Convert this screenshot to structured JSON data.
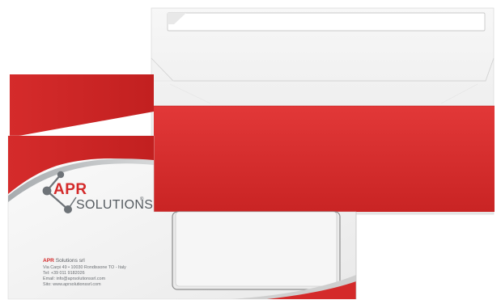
{
  "brand": {
    "apr": "APR",
    "solutions": "SOLUTIONS",
    "registered": "®"
  },
  "address": {
    "company_prefix": "APR",
    "company_rest": " Solutions srl",
    "street": "Via Carpi 49 • 10030 Rondissone TO - Italy",
    "tel": "Tel:   +39 011 9182026",
    "email": "Email: info@aprsolutionssrl.com",
    "site": "Sito: www.aprsolutionssrl.com"
  },
  "colors": {
    "brand_red": "#d42a2a",
    "envelope_white": "#f4f4f4",
    "logo_grey": "#6e7378"
  },
  "icons": {
    "logo_mark": "molecule-logo-icon"
  }
}
